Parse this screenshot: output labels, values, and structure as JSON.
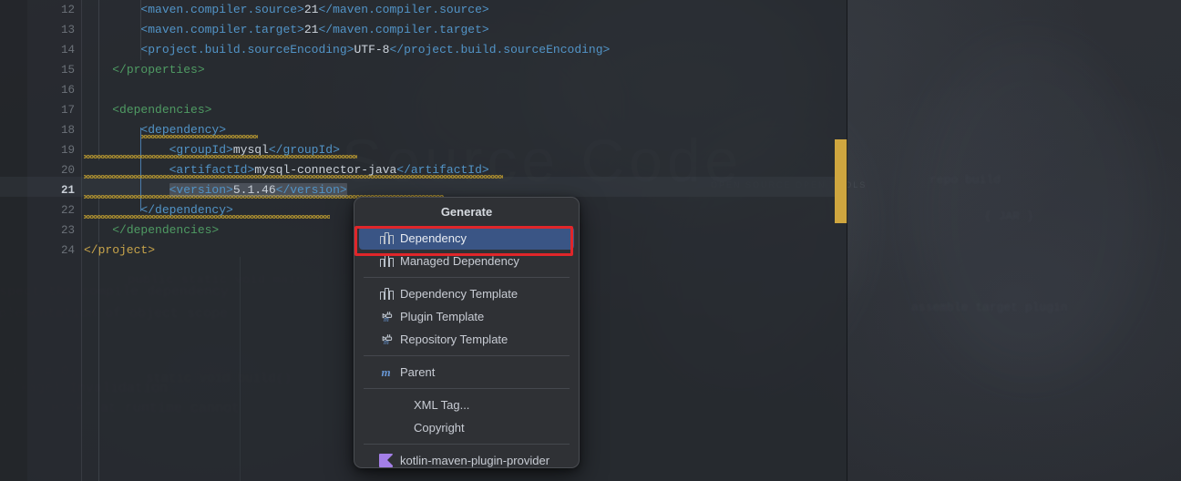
{
  "editor": {
    "background_image_text": "Source Code",
    "background_image_subtext": "OPEN SOURCE   OPEN TOOLS",
    "lines": [
      {
        "number": "12",
        "indent": 8,
        "segments": [
          {
            "t": "<maven.compiler.source>",
            "c": "tag"
          },
          {
            "t": "21",
            "c": "num"
          },
          {
            "t": "</maven.compiler.source>",
            "c": "tag"
          }
        ]
      },
      {
        "number": "13",
        "indent": 8,
        "segments": [
          {
            "t": "<maven.compiler.target>",
            "c": "tag"
          },
          {
            "t": "21",
            "c": "num"
          },
          {
            "t": "</maven.compiler.target>",
            "c": "tag"
          }
        ]
      },
      {
        "number": "14",
        "indent": 8,
        "segments": [
          {
            "t": "<project.build.sourceEncoding>",
            "c": "tag"
          },
          {
            "t": "UTF-8",
            "c": "num"
          },
          {
            "t": "</project.build.sourceEncoding>",
            "c": "tag"
          }
        ]
      },
      {
        "number": "15",
        "indent": 4,
        "segments": [
          {
            "t": "</properties>",
            "c": "gtag"
          }
        ]
      },
      {
        "number": "16",
        "indent": 0,
        "segments": []
      },
      {
        "number": "17",
        "indent": 4,
        "segments": [
          {
            "t": "<dependencies>",
            "c": "gtag"
          }
        ]
      },
      {
        "number": "18",
        "indent": 8,
        "segments": [
          {
            "t": "<dependency>",
            "c": "tag"
          }
        ]
      },
      {
        "number": "19",
        "indent": 12,
        "segments": [
          {
            "t": "<groupId>",
            "c": "tag"
          },
          {
            "t": "mysql",
            "c": "txt"
          },
          {
            "t": "</groupId>",
            "c": "tag"
          }
        ]
      },
      {
        "number": "20",
        "indent": 12,
        "segments": [
          {
            "t": "<artifactId>",
            "c": "tag"
          },
          {
            "t": "mysql-connector-java",
            "c": "txt"
          },
          {
            "t": "</artifactId>",
            "c": "tag"
          }
        ]
      },
      {
        "number": "21",
        "indent": 12,
        "current": true,
        "selected": true,
        "segments": [
          {
            "t": "<version>",
            "c": "tag"
          },
          {
            "t": "5.1.46",
            "c": "txt"
          },
          {
            "t": "</version>",
            "c": "tag"
          }
        ]
      },
      {
        "number": "22",
        "indent": 8,
        "segments": [
          {
            "t": "</dependency>",
            "c": "tag"
          }
        ]
      },
      {
        "number": "23",
        "indent": 4,
        "segments": [
          {
            "t": "</dependencies>",
            "c": "gtag"
          }
        ]
      },
      {
        "number": "24",
        "indent": 0,
        "segments": [
          {
            "t": "</project>",
            "c": "ytag"
          }
        ]
      }
    ],
    "scroll_marker_color": "#cfa63f"
  },
  "popup": {
    "title": "Generate",
    "items": [
      {
        "label": "Dependency",
        "icon": "dependency-icon",
        "selected": true
      },
      {
        "label": "Managed Dependency",
        "icon": "dependency-icon"
      },
      {
        "separator": true
      },
      {
        "label": "Dependency Template",
        "icon": "dependency-icon"
      },
      {
        "label": "Plugin Template",
        "icon": "plugin-icon"
      },
      {
        "label": "Repository Template",
        "icon": "plugin-icon"
      },
      {
        "separator": true
      },
      {
        "label": "Parent",
        "icon": "maven-m-icon"
      },
      {
        "separator": true
      },
      {
        "label": "XML Tag...",
        "icon": "none"
      },
      {
        "label": "Copyright",
        "icon": "none"
      },
      {
        "separator": true
      },
      {
        "label": "kotlin-maven-plugin-provider",
        "icon": "kotlin-icon"
      }
    ],
    "selection_color": "#3a5585",
    "highlight_box_color": "#e0262a"
  }
}
